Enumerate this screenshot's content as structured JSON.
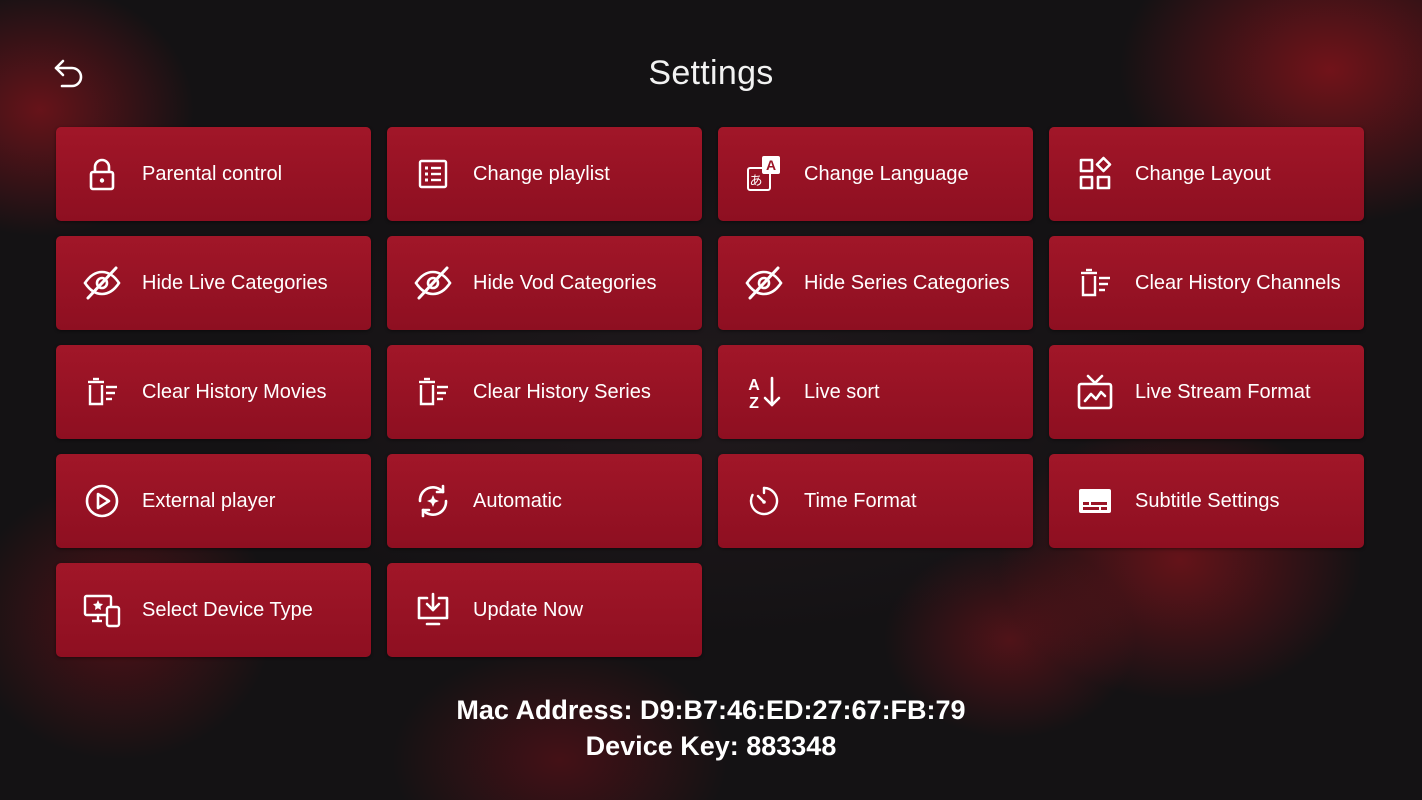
{
  "header": {
    "title": "Settings",
    "back_icon": "back-arrow-icon"
  },
  "tiles": [
    {
      "label": "Parental control",
      "icon": "lock-icon"
    },
    {
      "label": "Change playlist",
      "icon": "list-icon"
    },
    {
      "label": "Change Language",
      "icon": "translate-icon"
    },
    {
      "label": "Change Layout",
      "icon": "layout-icon"
    },
    {
      "label": "Hide Live Categories",
      "icon": "eye-off-icon"
    },
    {
      "label": "Hide Vod Categories",
      "icon": "eye-off-icon"
    },
    {
      "label": "Hide Series Categories",
      "icon": "eye-off-icon"
    },
    {
      "label": "Clear History Channels",
      "icon": "delete-list-icon"
    },
    {
      "label": "Clear History Movies",
      "icon": "delete-list-icon"
    },
    {
      "label": "Clear History Series",
      "icon": "delete-list-icon"
    },
    {
      "label": "Live sort",
      "icon": "sort-az-icon"
    },
    {
      "label": "Live Stream Format",
      "icon": "tv-icon"
    },
    {
      "label": "External player",
      "icon": "play-circle-icon"
    },
    {
      "label": "Automatic",
      "icon": "refresh-icon"
    },
    {
      "label": "Time Format",
      "icon": "timer-icon"
    },
    {
      "label": "Subtitle Settings",
      "icon": "subtitles-icon"
    },
    {
      "label": "Select Device Type",
      "icon": "devices-icon"
    },
    {
      "label": "Update Now",
      "icon": "download-icon"
    }
  ],
  "device_info": {
    "mac_address": "Mac Address: D9:B7:46:ED:27:67:FB:79",
    "device_key": "Device Key: 883348"
  },
  "colors": {
    "tile": "#9b1426",
    "background": "#141214",
    "text": "#ffffff"
  }
}
